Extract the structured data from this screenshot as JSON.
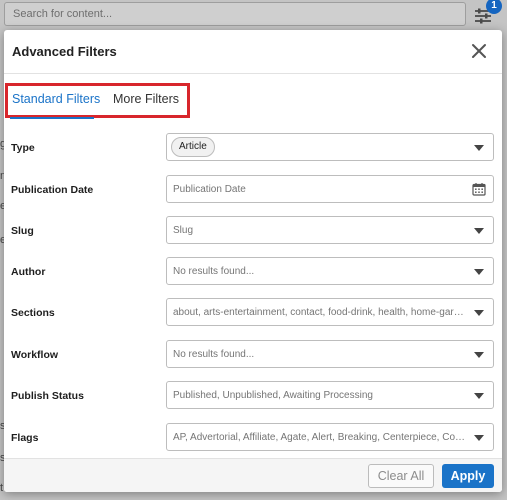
{
  "background": {
    "search_placeholder": "Search for content...",
    "filter_badge_count": "1",
    "side_letters": [
      "g",
      "n",
      "e",
      "er",
      "s",
      "s",
      "t"
    ]
  },
  "dialog": {
    "title": "Advanced Filters",
    "tabs": [
      {
        "label": "Standard Filters",
        "active": true
      },
      {
        "label": "More Filters",
        "active": false
      }
    ],
    "fields": [
      {
        "label": "Type",
        "chip": "Article",
        "placeholder": "",
        "control": "select"
      },
      {
        "label": "Publication Date",
        "chip": "",
        "placeholder": "Publication Date",
        "control": "date"
      },
      {
        "label": "Slug",
        "chip": "",
        "placeholder": "Slug",
        "control": "select"
      },
      {
        "label": "Author",
        "chip": "",
        "placeholder": "No results found...",
        "control": "select"
      },
      {
        "label": "Sections",
        "chip": "",
        "placeholder": "about, arts-entertainment, contact, food-drink, health, home-garden, news",
        "control": "select"
      },
      {
        "label": "Workflow",
        "chip": "",
        "placeholder": "No results found...",
        "control": "select"
      },
      {
        "label": "Publish Status",
        "chip": "",
        "placeholder": "Published, Unpublished, Awaiting Processing",
        "control": "select"
      },
      {
        "label": "Flags",
        "chip": "",
        "placeholder": "AP, Advertorial, Affiliate, Agate, Alert, Breaking, Centerpiece, Contributed",
        "control": "select"
      }
    ],
    "footer": {
      "clear_label": "Clear All",
      "apply_label": "Apply"
    }
  },
  "colors": {
    "accent": "#1a73c8",
    "highlight_box": "#d8262c",
    "overlay": "#c4c4c4"
  },
  "icons": {
    "close": "close-icon",
    "calendar": "calendar-icon",
    "dropdown": "chevron-down-icon",
    "filter": "filter-sliders-icon"
  }
}
